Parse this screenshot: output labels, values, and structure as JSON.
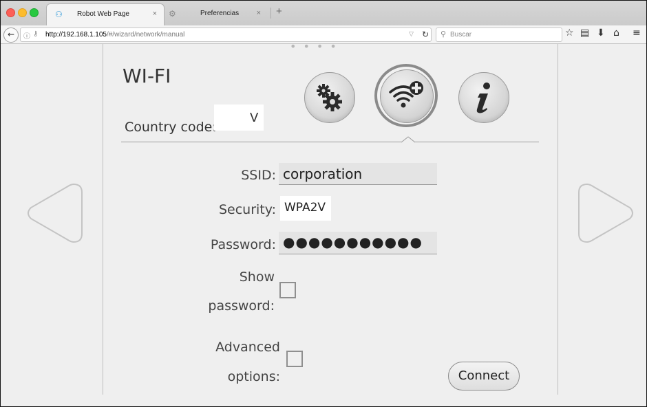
{
  "browser": {
    "tabs": [
      {
        "title": "Robot Web Page",
        "icon": "robot-icon"
      },
      {
        "title": "Preferencias",
        "icon": "gear-icon"
      }
    ],
    "url_host": "http://192.168.1.105",
    "url_path": "/#/wizard/network/manual",
    "search_placeholder": "Buscar"
  },
  "wifi": {
    "title": "WI-FI",
    "country_label": "Country code:",
    "country_value": "",
    "ssid_label": "SSID:",
    "ssid_value": "corporation",
    "security_label": "Security:",
    "security_value": "WPA2",
    "password_label": "Password:",
    "password_value": "●●●●●●●●●●●",
    "show_password_line1": "Show",
    "show_password_line2": "password:",
    "advanced_line1": "Advanced",
    "advanced_line2": "options:",
    "connect_label": "Connect",
    "chevron": "V"
  },
  "colors": {
    "page_bg": "#efefef",
    "field_bg": "#e4e4e4",
    "accent_ring": "#8b8b8b"
  }
}
